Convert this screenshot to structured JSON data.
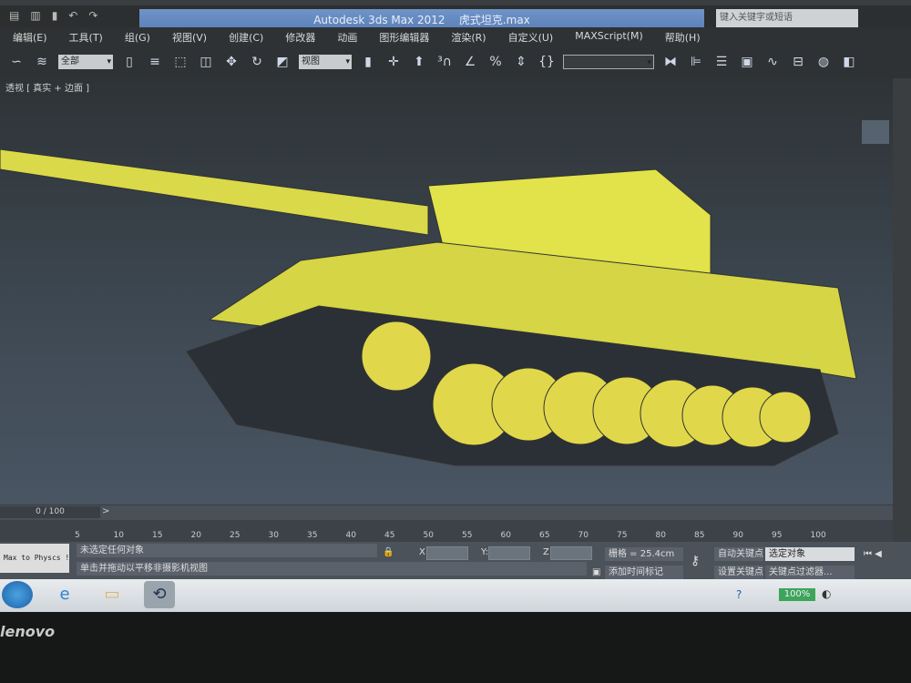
{
  "window": {
    "title": "Autodesk 3ds Max  2012",
    "file": "虎式坦克.max",
    "search_placeholder": "键入关键字或短语"
  },
  "menu": [
    "编辑(E)",
    "工具(T)",
    "组(G)",
    "视图(V)",
    "创建(C)",
    "修改器",
    "动画",
    "图形编辑器",
    "渲染(R)",
    "自定义(U)",
    "MAXScript(M)",
    "帮助(H)"
  ],
  "toolbar": {
    "filter": "全部",
    "ref_coord": "视图",
    "named_selection": ""
  },
  "viewport": {
    "label": "透视 [ 真实 + 边面 ]",
    "model_color": "#e2e24a"
  },
  "timeline": {
    "frame": "0 / 100",
    "ticks": [
      "5",
      "10",
      "15",
      "20",
      "25",
      "30",
      "35",
      "40",
      "45",
      "50",
      "55",
      "60",
      "65",
      "70",
      "75",
      "80",
      "85",
      "90",
      "95",
      "100"
    ]
  },
  "status": {
    "maxscript": "Max to Physcs !",
    "selection": "未选定任何对象",
    "prompt": "单击并拖动以平移非摄影机视图",
    "x_label": "X:",
    "y_label": "Y:",
    "z_label": "Z:",
    "grid": "栅格 = 25.4cm",
    "add_time_tag": "添加时间标记",
    "auto_key": "自动关键点",
    "key_mode": "选定对象",
    "set_key": "设置关键点",
    "key_filters": "关键点过滤器..."
  },
  "taskbar": {
    "battery": "100%"
  },
  "bezel": {
    "brand": "lenovo"
  }
}
